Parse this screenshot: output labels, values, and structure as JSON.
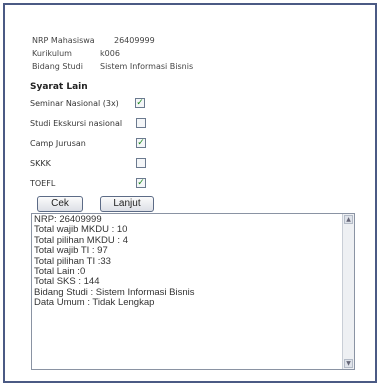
{
  "info": {
    "nrp_label": "NRP Mahasiswa",
    "nrp_value": "26409999",
    "kurikulum_label": "Kurikulum",
    "kurikulum_value": "k006",
    "bidang_label": "Bidang Studi",
    "bidang_value": "Sistem Informasi Bisnis"
  },
  "syarat": {
    "title": "Syarat Lain",
    "items": [
      {
        "label": "Seminar Nasional (3x)",
        "checked": true
      },
      {
        "label": "Studi Ekskursi nasional",
        "checked": false
      },
      {
        "label": "Camp Jurusan",
        "checked": true
      },
      {
        "label": "SKKK",
        "checked": false
      },
      {
        "label": "TOEFL",
        "checked": true
      }
    ]
  },
  "buttons": {
    "cek": "Cek",
    "lanjut": "Lanjut"
  },
  "output": {
    "lines": [
      "NRP: 26409999",
      "Total wajib MKDU : 10",
      "Total pilihan MKDU : 4",
      "Total wajib TI : 97",
      "Total pilihan TI :33",
      "Total Lain :0",
      "Total SKS : 144",
      "Bidang Studi : Sistem Informasi Bisnis",
      "Data Umum : Tidak Lengkap"
    ]
  }
}
